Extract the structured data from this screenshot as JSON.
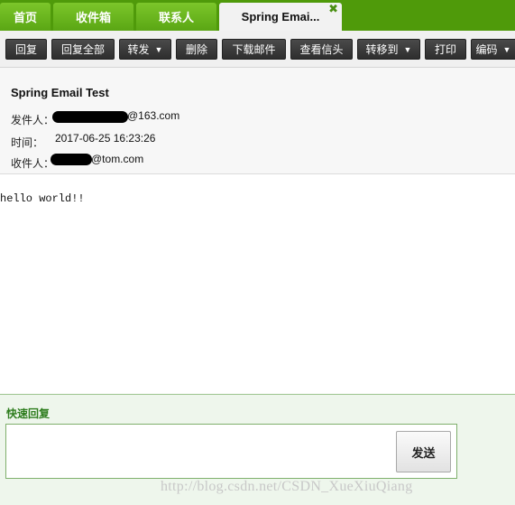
{
  "tabs": [
    {
      "label": "首页"
    },
    {
      "label": "收件箱"
    },
    {
      "label": "联系人"
    },
    {
      "label": "Spring Emai...",
      "close_icon": "✖"
    }
  ],
  "toolbar": {
    "reply": "回复",
    "reply_all": "回复全部",
    "forward": "转发",
    "delete": "删除",
    "download": "下载邮件",
    "view_header": "查看信头",
    "move_to": "转移到",
    "print": "打印",
    "encoding": "编码",
    "caret": "▼"
  },
  "mail": {
    "subject": "Spring Email Test",
    "from_label": "发件人：",
    "from_value": "@163.com",
    "time_label": "时间：",
    "time_value": "2017-06-25 16:23:26",
    "to_label": "收件人：",
    "to_value": "@tom.com",
    "body": "hello world!!"
  },
  "quick_reply": {
    "label": "快速回复",
    "placeholder": "",
    "send": "发送"
  },
  "watermark": "http://blog.csdn.net/CSDN_XueXiuQiang"
}
